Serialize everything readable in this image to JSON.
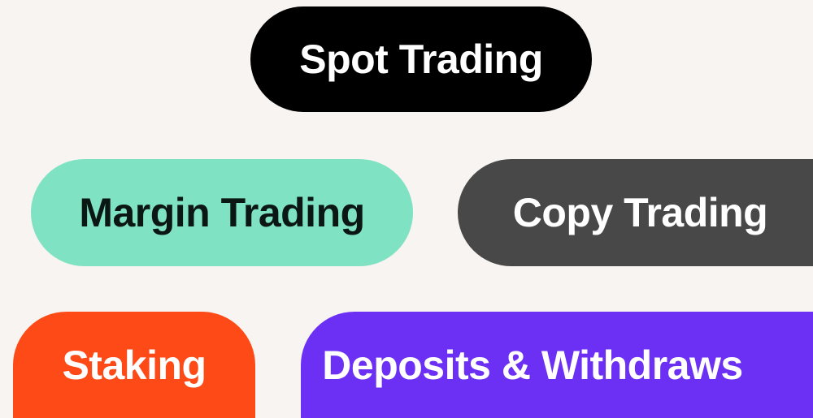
{
  "colors": {
    "background": "#f8f4f1"
  },
  "pills": [
    {
      "id": "spot",
      "label": "Spot Trading",
      "background": "#000000",
      "text_color": "#ffffff"
    },
    {
      "id": "margin",
      "label": "Margin Trading",
      "background": "#7fe2c2",
      "text_color": "#0b1712"
    },
    {
      "id": "copy",
      "label": "Copy Trading",
      "background": "#484848",
      "text_color": "#ffffff"
    },
    {
      "id": "staking",
      "label": "Staking",
      "background": "#fd4a16",
      "text_color": "#ffffff"
    },
    {
      "id": "deposits",
      "label": "Deposits & Withdraws",
      "background": "#6b30f4",
      "text_color": "#ffffff"
    }
  ]
}
